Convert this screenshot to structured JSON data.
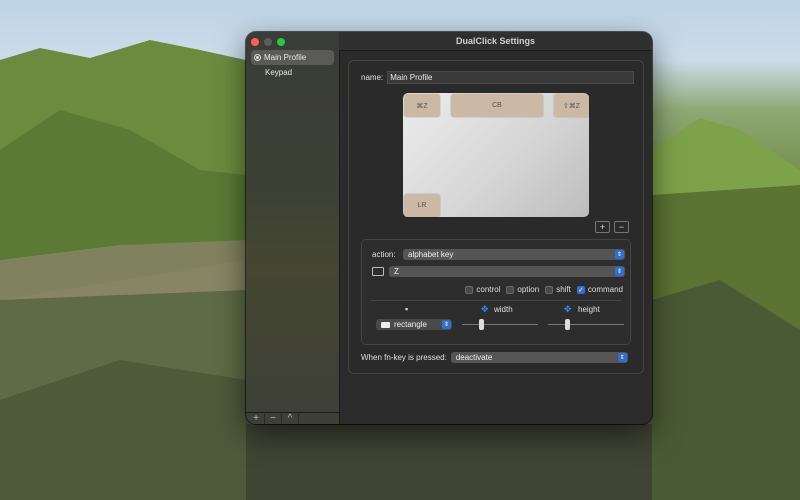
{
  "window": {
    "title": "DualClick Settings"
  },
  "sidebar": {
    "items": [
      {
        "label": "Main Profile",
        "selected": true
      },
      {
        "label": "Keypad",
        "selected": false
      }
    ],
    "footer": [
      "+",
      "−",
      "^"
    ]
  },
  "profile": {
    "name_label": "name:",
    "name_value": "Main Profile"
  },
  "preview": {
    "keys": [
      {
        "label": "⌘Z"
      },
      {
        "label": "CB"
      },
      {
        "label": "⇧⌘Z"
      },
      {
        "label": "LR"
      }
    ]
  },
  "add_remove": {
    "add": "+",
    "remove": "−"
  },
  "action": {
    "label": "action:",
    "value": "alphabet key",
    "key_value": "Z",
    "modifiers": [
      {
        "label": "control",
        "checked": false
      },
      {
        "label": "option",
        "checked": false
      },
      {
        "label": "shift",
        "checked": false
      },
      {
        "label": "command",
        "checked": true
      }
    ],
    "shape_value": "rectangle",
    "width_label": "width",
    "height_label": "height",
    "width_level": 0.25,
    "height_level": 0.25
  },
  "fn": {
    "label": "When fn-key is pressed:",
    "value": "deactivate"
  },
  "colors": {
    "accent": "#2f6fd4",
    "key": "#cbb9a5"
  }
}
